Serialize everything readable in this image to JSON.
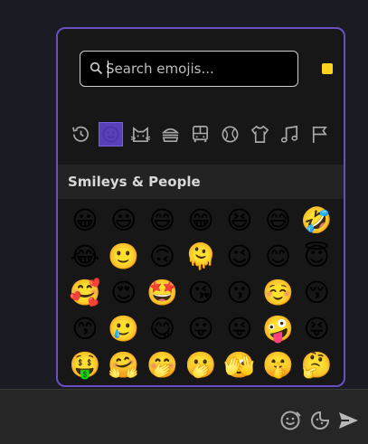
{
  "search": {
    "placeholder": "Search emojis..."
  },
  "skin_tone_color": "#ffd21f",
  "accent_color": "#6a4fc0",
  "categories": [
    {
      "icon": "clock-history-icon",
      "label": "Recent"
    },
    {
      "icon": "smiley-icon",
      "label": "Smileys & People",
      "active": true
    },
    {
      "icon": "cat-icon",
      "label": "Animals & Nature"
    },
    {
      "icon": "burger-icon",
      "label": "Food & Drink"
    },
    {
      "icon": "bus-icon",
      "label": "Travel & Places"
    },
    {
      "icon": "ball-icon",
      "label": "Activities"
    },
    {
      "icon": "shirt-icon",
      "label": "Objects"
    },
    {
      "icon": "music-note-icon",
      "label": "Symbols"
    },
    {
      "icon": "flag-icon",
      "label": "Flags"
    }
  ],
  "section_title": "Smileys & People",
  "emoji_rows": [
    [
      "😀",
      "😃",
      "😄",
      "😁",
      "😆",
      "😅",
      "🤣"
    ],
    [
      "😂",
      "🙂",
      "🙃",
      "🫠",
      "😉",
      "😊",
      "😇"
    ],
    [
      "🥰",
      "😍",
      "🤩",
      "😘",
      "😗",
      "☺️",
      "😚"
    ],
    [
      "😙",
      "🥲",
      "😋",
      "😛",
      "😜",
      "🤪",
      "😝"
    ],
    [
      "🤑",
      "🤗",
      "🤭",
      "🫢",
      "🫣",
      "🤫",
      "🤔"
    ],
    [
      "🫡",
      "🤐",
      "🤨",
      "😐",
      "😑",
      "😶",
      "🫥"
    ]
  ],
  "bottom_bar": {
    "icons": [
      "gif-sticker-icon",
      "emoji-sticker-icon",
      "send-icon"
    ]
  }
}
